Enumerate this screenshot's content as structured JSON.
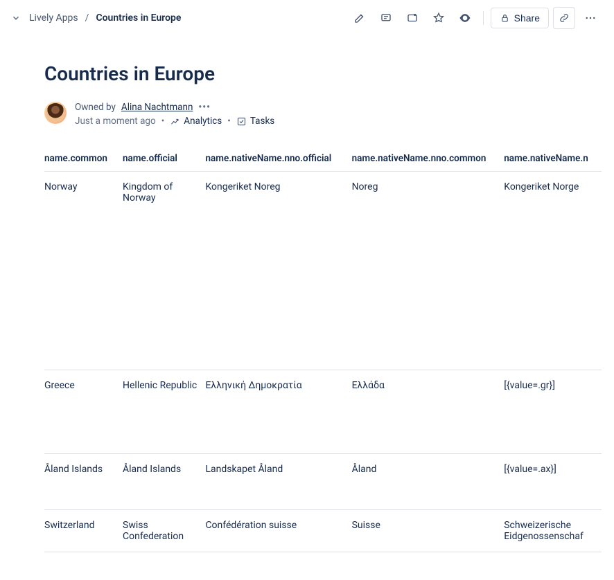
{
  "breadcrumbs": {
    "parent": "Lively Apps",
    "current": "Countries in Europe"
  },
  "page": {
    "title": "Countries in Europe"
  },
  "meta": {
    "owned_by_label": "Owned by",
    "owner_name": "Alina Nachtmann",
    "timestamp": "Just a moment ago",
    "analytics_label": "Analytics",
    "tasks_label": "Tasks"
  },
  "toolbar": {
    "share_label": "Share"
  },
  "table": {
    "headers": [
      "name.common",
      "name.official",
      "name.nativeName.nno.official",
      "name.nativeName.nno.common",
      "name.nativeName.n"
    ],
    "rows": [
      {
        "c0": "Norway",
        "c1": "Kingdom of Norway",
        "c2": "Kongeriket Noreg",
        "c3": "Noreg",
        "c4": "Kongeriket Norge"
      },
      {
        "c0": "Greece",
        "c1": "Hellenic Republic",
        "c2": "Ελληνική Δημοκρατία",
        "c3": "Ελλάδα",
        "c4": "[{value=.gr}]"
      },
      {
        "c0": "Åland Islands",
        "c1": "Åland Islands",
        "c2": "Landskapet Åland",
        "c3": "Åland",
        "c4": "[{value=.ax}]"
      },
      {
        "c0": "Switzerland",
        "c1": "Swiss Confederation",
        "c2": "Confédération suisse",
        "c3": "Suisse",
        "c4": "Schweizerische Eidgenossenschaf"
      }
    ]
  }
}
